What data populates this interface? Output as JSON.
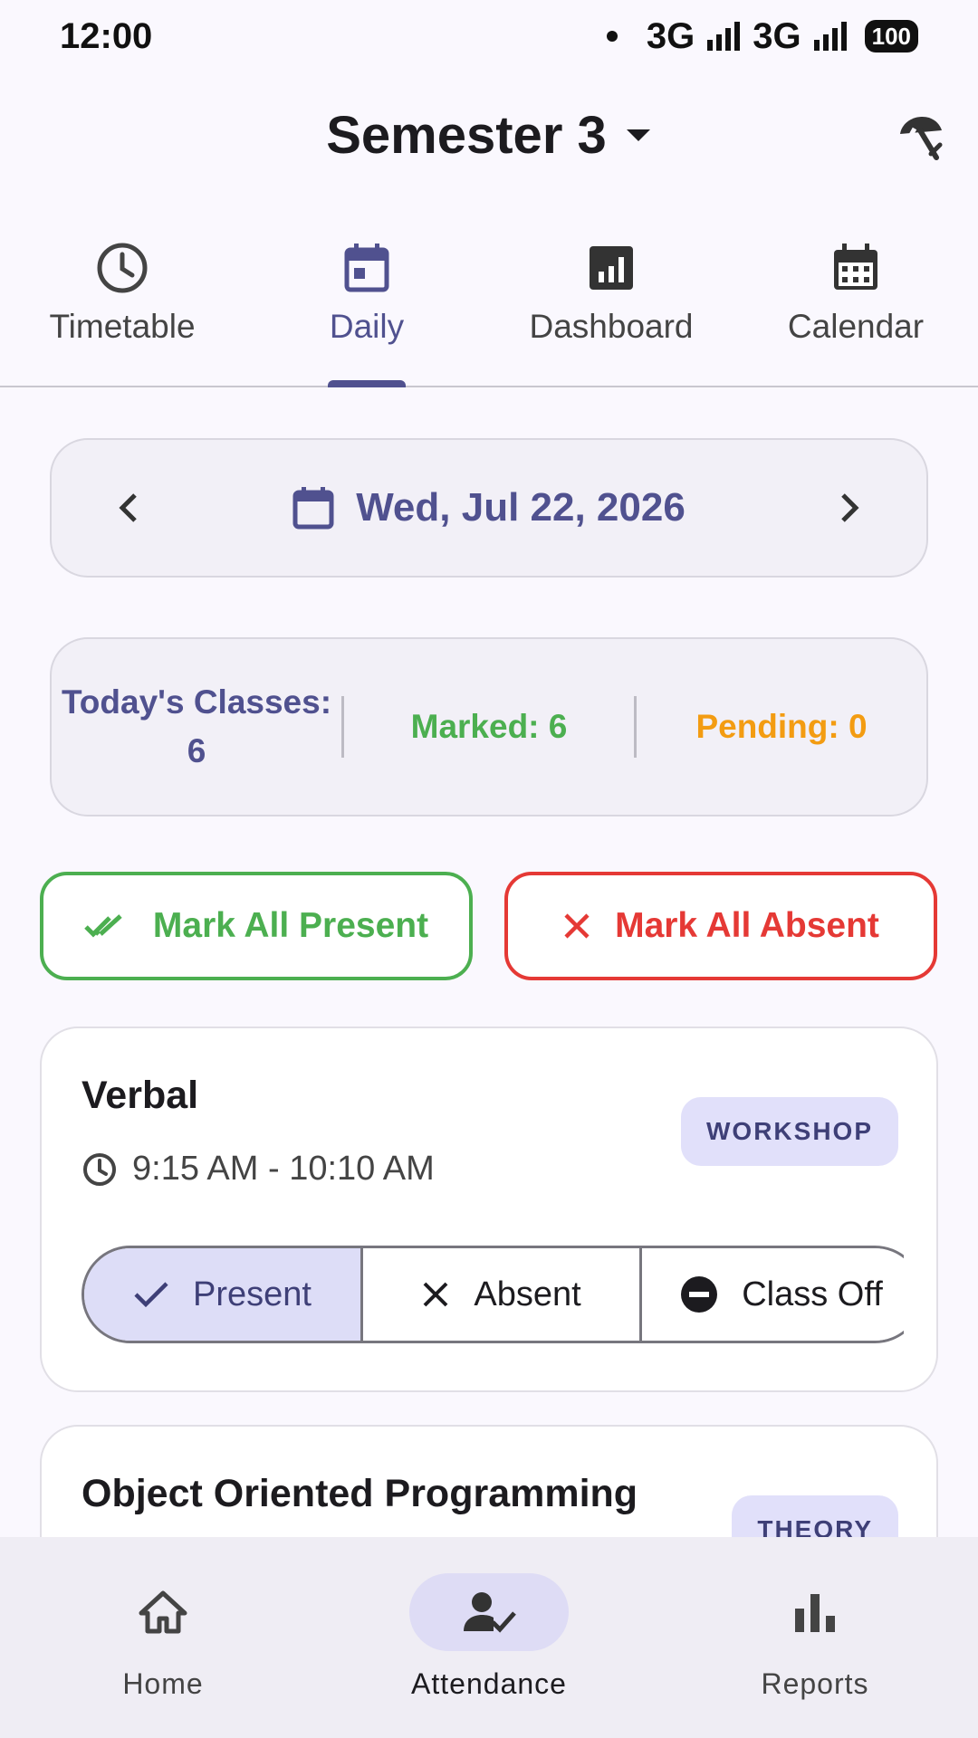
{
  "status_bar": {
    "time": "12:00",
    "network1": "3G",
    "network2": "3G",
    "battery": "100"
  },
  "header": {
    "title": "Semester 3",
    "dropdown_icon": "arrow-drop-down-icon",
    "action_icon": "umbrella-off-icon"
  },
  "tabs": [
    {
      "label": "Timetable",
      "icon": "clock-icon",
      "active": false
    },
    {
      "label": "Daily",
      "icon": "calendar-today-icon",
      "active": true
    },
    {
      "label": "Dashboard",
      "icon": "bar-chart-icon",
      "active": false
    },
    {
      "label": "Calendar",
      "icon": "calendar-month-icon",
      "active": false
    }
  ],
  "date_selector": {
    "date": "Wed, Jul 22, 2026"
  },
  "summary": {
    "total_label": "Today's Classes:",
    "total_value": "6",
    "marked": "Marked: 6",
    "pending": "Pending: 0"
  },
  "bulk_actions": {
    "present_label": "Mark All Present",
    "absent_label": "Mark All Absent"
  },
  "classes": [
    {
      "name": "Verbal",
      "type": "WORKSHOP",
      "time": "9:15 AM - 10:10 AM",
      "options": {
        "present": "Present",
        "absent": "Absent",
        "off": "Class Off"
      },
      "selected": "present"
    },
    {
      "name": "Object Oriented Programming",
      "type": "THEORY"
    }
  ],
  "bottom_nav": [
    {
      "label": "Home",
      "icon": "home-icon",
      "active": false
    },
    {
      "label": "Attendance",
      "icon": "attendance-icon",
      "active": true
    },
    {
      "label": "Reports",
      "icon": "bar-chart-icon",
      "active": false
    }
  ],
  "colors": {
    "primary": "#50518F",
    "present": "#4CAF50",
    "absent": "#E53935",
    "pending": "#F39C12",
    "badge_bg": "#E1E0FA"
  }
}
